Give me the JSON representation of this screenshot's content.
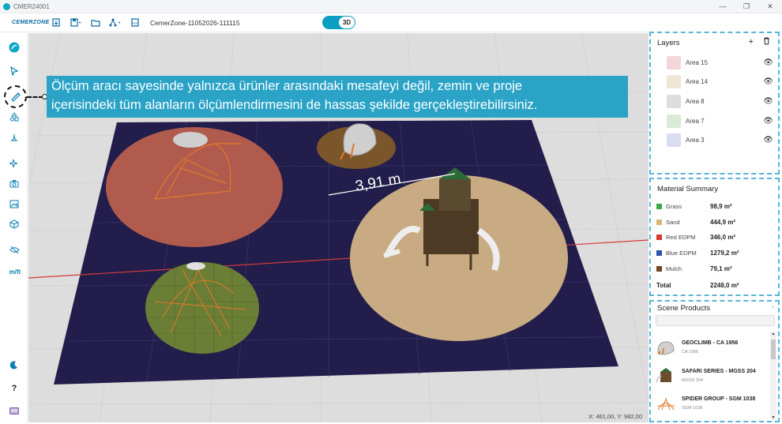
{
  "window": {
    "title": "CMER24001"
  },
  "toolbar": {
    "logo": "CEMERZONE",
    "project_name": "CemerZone-11052026-111115",
    "view_mode": "3D"
  },
  "tooltip": {
    "line1": "Ölçüm aracı sayesinde yalnızca ürünler arasındaki mesafeyi değil, zemin ve proje",
    "line2": "içerisindeki tüm alanların ölçümlendirmesini de hassas şekilde gerçekleştirebilirsiniz."
  },
  "viewport": {
    "measurement": "3,91 m",
    "coordinates": "X: 461,00, Y: 982,00"
  },
  "sidebar": {
    "units_label": "m/ft",
    "help_label": "?"
  },
  "layers": {
    "title": "Layers",
    "items": [
      {
        "label": "Area 15",
        "color": "#f3d6da"
      },
      {
        "label": "Area 14",
        "color": "#efe6d6"
      },
      {
        "label": "Area 8",
        "color": "#dedcdc"
      },
      {
        "label": "Area 7",
        "color": "#d9ead6"
      },
      {
        "label": "Area 3",
        "color": "#dadcef"
      }
    ]
  },
  "material_summary": {
    "title": "Material Summary",
    "rows": [
      {
        "name": "Grass",
        "value": "98,9 m²",
        "color": "#3aa84a"
      },
      {
        "name": "Sand",
        "value": "444,9 m²",
        "color": "#d8b57a"
      },
      {
        "name": "Red EDPM",
        "value": "346,0 m²",
        "color": "#d63a2e"
      },
      {
        "name": "Blue EDPM",
        "value": "1279,2 m²",
        "color": "#2c55a6"
      },
      {
        "name": "Mulch",
        "value": "79,1 m²",
        "color": "#6e4a22"
      }
    ],
    "total_label": "Total",
    "total_value": "2248,0 m²"
  },
  "scene_products": {
    "title": "Scene Products",
    "items": [
      {
        "name": "GEOCLIMB - CA 1956",
        "code": "CA 1956"
      },
      {
        "name": "SAFARI SERIES - MGSS 204",
        "code": "MGSS 204"
      },
      {
        "name": "SPIDER GROUP - SGM 1038",
        "code": "SGM 1038"
      }
    ]
  }
}
